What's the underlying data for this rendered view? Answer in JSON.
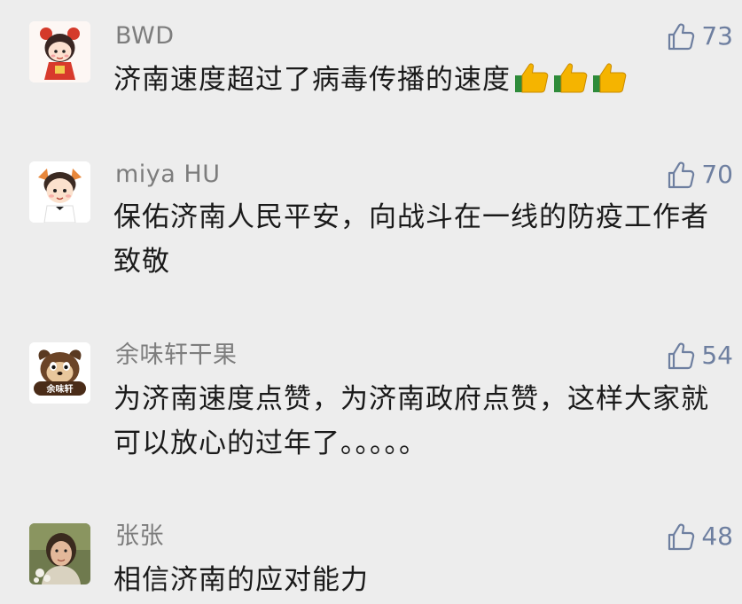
{
  "comments": [
    {
      "author": "BWD",
      "likes": "73",
      "text": "济南速度超过了病毒传播的速度",
      "emoji_icons": [
        "thumbs-up-emoji",
        "thumbs-up-emoji",
        "thumbs-up-emoji"
      ],
      "avatar_icon": "cartoon-girl-avatar"
    },
    {
      "author": "miya HU",
      "likes": "70",
      "text": "保佑济南人民平安，向战斗在一线的防疫工作者致敬",
      "avatar_icon": "cartoon-child-avatar"
    },
    {
      "author": "余味轩干果",
      "likes": "54",
      "text": "为济南速度点赞，为济南政府点赞，这样大家就可以放心的过年了。。。。。",
      "avatar_icon": "squirrel-logo-avatar",
      "avatar_logo_text": "余味轩"
    },
    {
      "author": "张张",
      "likes": "48",
      "text": "相信济南的应对能力",
      "avatar_icon": "photo-avatar"
    }
  ],
  "colors": {
    "background": "#ededed",
    "author": "#7d7d7d",
    "like": "#6e7fa0",
    "text": "#1a1a1a"
  }
}
